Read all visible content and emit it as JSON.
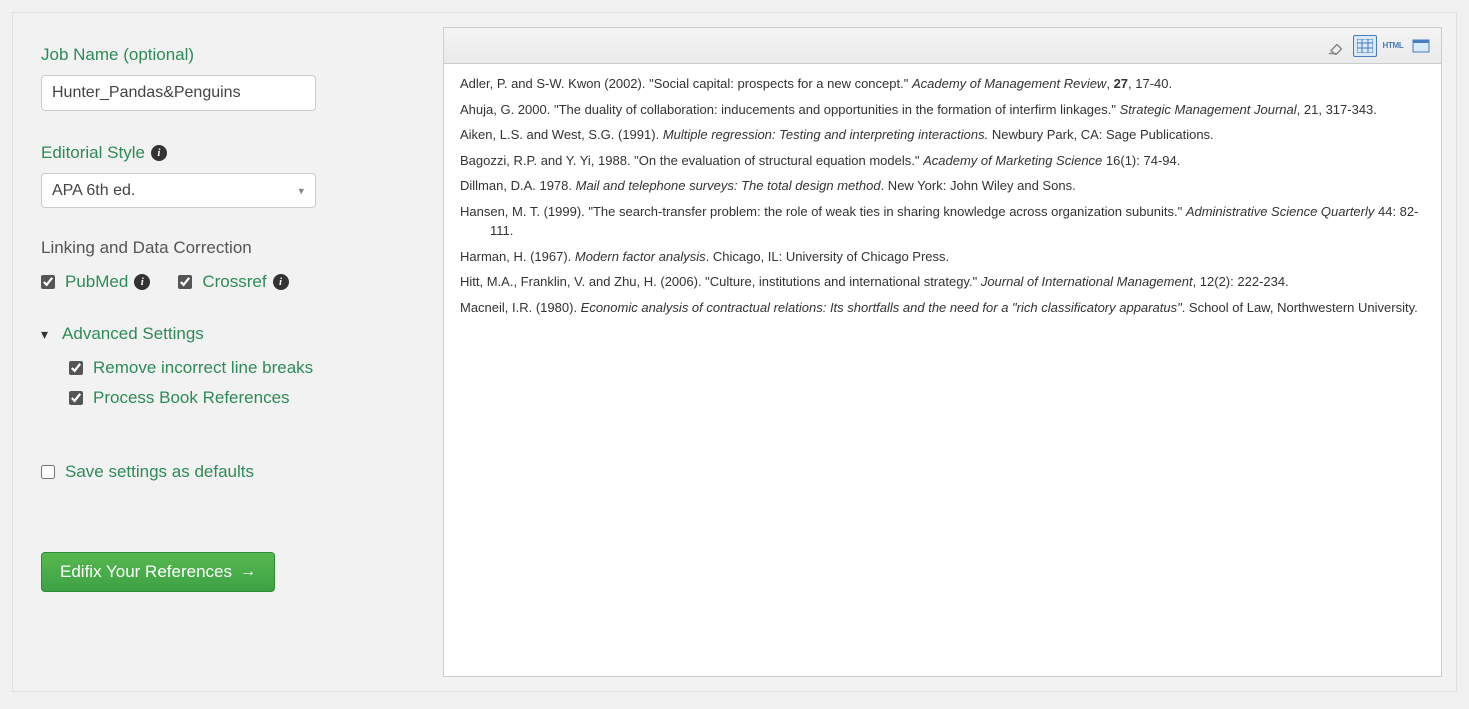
{
  "sidebar": {
    "job_name_label": "Job Name (optional)",
    "job_name_value": "Hunter_Pandas&Penguins",
    "editorial_style_label": "Editorial Style",
    "editorial_style_value": "APA 6th ed.",
    "linking_label": "Linking and Data Correction",
    "pubmed_label": "PubMed",
    "pubmed_checked": true,
    "crossref_label": "Crossref",
    "crossref_checked": true,
    "advanced_label": "Advanced Settings",
    "remove_breaks_label": "Remove incorrect line breaks",
    "remove_breaks_checked": true,
    "process_books_label": "Process Book References",
    "process_books_checked": true,
    "save_defaults_label": "Save settings as defaults",
    "save_defaults_checked": false,
    "action_button_label": "Edifix Your References"
  },
  "toolbar": {
    "html_label": "HTML"
  },
  "references": [
    {
      "html": "Adler, P. and S-W. Kwon (2002). \"Social capital: prospects for a new concept.\" <em>Academy of Management Review</em>, <b>27</b>, 17-40."
    },
    {
      "html": "Ahuja, G. 2000. \"The duality of collaboration: inducements and opportunities in the formation of interfirm linkages.\" <em>Strategic Management Journal</em>, 21, 317-343."
    },
    {
      "html": "Aiken, L.S. and West, S.G. (1991). <em>Multiple regression: Testing and interpreting interactions.</em> Newbury Park, CA: Sage Publications."
    },
    {
      "html": "Bagozzi, R.P. and Y. Yi, 1988. \"On the evaluation of structural equation models.\" <em>Academy of Marketing Science</em> 16(1): 74-94."
    },
    {
      "html": "Dillman, D.A. 1978. <em>Mail and telephone surveys: The total design method</em>. New York: John Wiley and Sons."
    },
    {
      "html": "Hansen, M. T. (1999). \"The search-transfer problem: the role of weak ties in sharing knowledge across organization subunits.\" <em>Administrative Science Quarterly</em> 44: 82-111."
    },
    {
      "html": "Harman, H. (1967). <em>Modern factor analysis</em>. Chicago, IL: University of Chicago Press."
    },
    {
      "html": "Hitt, M.A., Franklin, V. and Zhu, H. (2006). \"Culture, institutions and international strategy.\" <em>Journal of International Management</em>, 12(2): 222-234."
    },
    {
      "html": "Macneil, I.R. (1980). <em>Economic analysis of contractual relations: Its shortfalls and the need for a \"rich classificatory apparatus\"</em>. School of Law, Northwestern University."
    }
  ]
}
